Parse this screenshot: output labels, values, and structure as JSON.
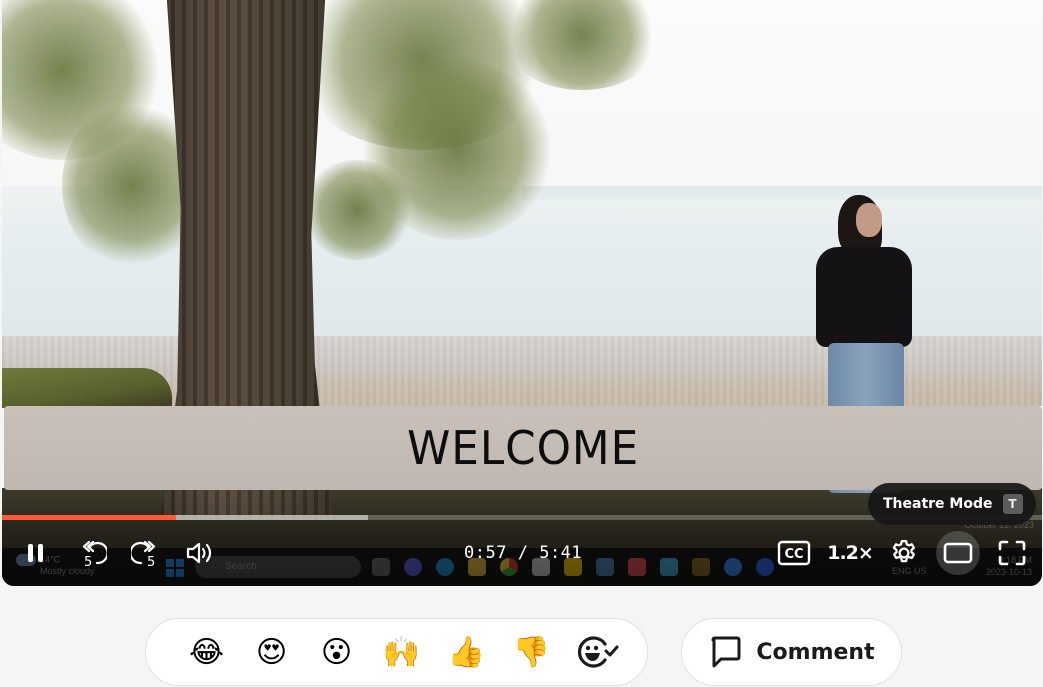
{
  "video": {
    "title_card_text": "WELCOME",
    "recorded_screen": {
      "weather_temp": "14°C",
      "weather_desc": "Mostly cloudy",
      "search_placeholder": "Search",
      "language": "ENG US",
      "clock_time": "3:18 PM",
      "clock_date": "2023-10-13",
      "date_popup": "October 13, 2023"
    }
  },
  "player": {
    "progress": {
      "played_fraction": 0.167,
      "buffered_fraction": 0.352
    },
    "controls": {
      "play_pause": {
        "state": "playing",
        "icon": "pause-icon"
      },
      "rewind": {
        "seconds": "5",
        "icon": "rewind-5-icon"
      },
      "forward": {
        "seconds": "5",
        "icon": "forward-5-icon"
      },
      "volume": {
        "icon": "volume-icon"
      },
      "current_time": "0:57",
      "separator": "/",
      "duration": "5:41",
      "captions": {
        "label": "CC"
      },
      "speed": {
        "label": "1.2×"
      },
      "settings": {
        "icon": "gear-icon"
      },
      "theatre": {
        "icon": "theatre-mode-icon"
      },
      "fullscreen": {
        "icon": "fullscreen-icon"
      }
    },
    "tooltip": {
      "label": "Theatre Mode",
      "shortcut": "T"
    },
    "accent_color": "#ff5a36"
  },
  "reactions": {
    "items": [
      {
        "name": "tears-of-joy",
        "glyph": "😂"
      },
      {
        "name": "heart-eyes",
        "glyph": "😍"
      },
      {
        "name": "surprised",
        "glyph": "😮"
      },
      {
        "name": "raised-hands",
        "glyph": "🙌"
      },
      {
        "name": "thumbs-up",
        "glyph": "👍"
      },
      {
        "name": "thumbs-down",
        "glyph": "👎"
      }
    ],
    "more_icon": "add-reaction-icon"
  },
  "comment_button": {
    "label": "Comment",
    "icon": "comment-icon"
  }
}
